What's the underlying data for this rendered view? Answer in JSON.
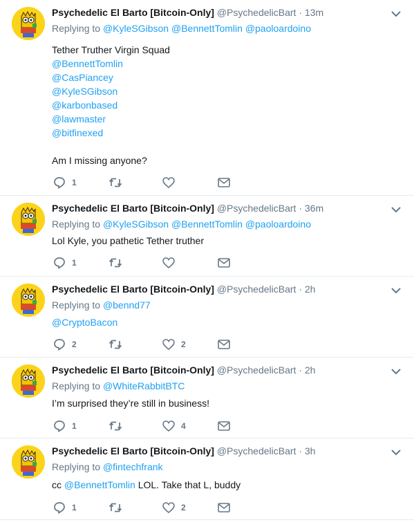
{
  "tweets": [
    {
      "fullname": "Psychedelic El Barto [Bitcoin-Only]",
      "handle": "@PsychedelicBart",
      "separator": "·",
      "time": "13m",
      "replying_prefix": "Replying to",
      "replying_to": [
        "@KyleSGibson",
        "@BennettTomlin",
        "@paoloardoino"
      ],
      "text_lines": [
        {
          "text": "Tether Truther Virgin Squad",
          "link": false
        },
        {
          "text": "@BennettTomlin",
          "link": true
        },
        {
          "text": "@CasPiancey",
          "link": true
        },
        {
          "text": "@KyleSGibson",
          "link": true
        },
        {
          "text": "@karbonbased",
          "link": true
        },
        {
          "text": "@lawmaster",
          "link": true
        },
        {
          "text": "@bitfinexed",
          "link": true
        },
        {
          "text": "",
          "link": false
        },
        {
          "text": "Am I missing anyone?",
          "link": false
        }
      ],
      "replies": "1",
      "retweets": "",
      "likes": "",
      "icons": {
        "reply": "reply-icon",
        "retweet": "retweet-icon",
        "like": "heart-icon",
        "dm": "envelope-icon",
        "caret": "chevron-down-icon"
      }
    },
    {
      "fullname": "Psychedelic El Barto [Bitcoin-Only]",
      "handle": "@PsychedelicBart",
      "separator": "·",
      "time": "36m",
      "replying_prefix": "Replying to",
      "replying_to": [
        "@KyleSGibson",
        "@BennettTomlin",
        "@paoloardoino"
      ],
      "text_lines": [
        {
          "text": "Lol Kyle, you pathetic Tether truther",
          "link": false
        }
      ],
      "replies": "1",
      "retweets": "",
      "likes": ""
    },
    {
      "fullname": "Psychedelic El Barto [Bitcoin-Only]",
      "handle": "@PsychedelicBart",
      "separator": "·",
      "time": "2h",
      "replying_prefix": "Replying to",
      "replying_to": [
        "@bennd77"
      ],
      "text_lines": [
        {
          "text": "@CryptoBacon",
          "link": true
        }
      ],
      "replies": "2",
      "retweets": "",
      "likes": "2"
    },
    {
      "fullname": "Psychedelic El Barto [Bitcoin-Only]",
      "handle": "@PsychedelicBart",
      "separator": "·",
      "time": "2h",
      "replying_prefix": "Replying to",
      "replying_to": [
        "@WhiteRabbitBTC"
      ],
      "text_lines": [
        {
          "text": "I’m surprised they’re still in business!",
          "link": false
        }
      ],
      "replies": "1",
      "retweets": "",
      "likes": "4"
    },
    {
      "fullname": "Psychedelic El Barto [Bitcoin-Only]",
      "handle": "@PsychedelicBart",
      "separator": "·",
      "time": "3h",
      "replying_prefix": "Replying to",
      "replying_to": [
        "@fintechfrank"
      ],
      "text_segments": [
        {
          "text": "cc ",
          "link": false
        },
        {
          "text": "@BennettTomlin",
          "link": true
        },
        {
          "text": " LOL. Take that L, buddy",
          "link": false
        }
      ],
      "replies": "1",
      "retweets": "",
      "likes": "2"
    }
  ],
  "colors": {
    "link": "#1da1f2",
    "muted": "#657786",
    "text": "#14171a",
    "avatar_bg": "#fbd31a",
    "border": "#e6ecf0"
  }
}
